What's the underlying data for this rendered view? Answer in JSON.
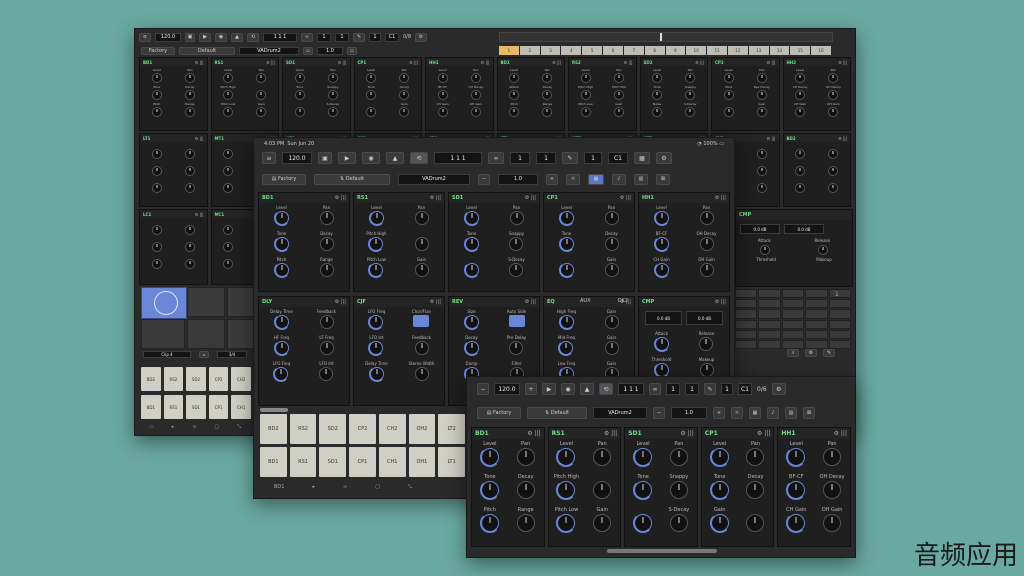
{
  "window_back": {
    "transport": {
      "tempo": "120.0",
      "position": "1 1 1",
      "loop_a": "1",
      "loop_b": "1",
      "loop_c": "1",
      "note": "C1",
      "ratio": "0/8"
    },
    "preset": {
      "factory_label": "Factory",
      "default_label": "Default",
      "name": "VADrum2",
      "value": "1.0"
    },
    "steps": [
      "1",
      "2",
      "3",
      "4",
      "5",
      "6",
      "7",
      "8",
      "9",
      "10",
      "11",
      "12",
      "13",
      "14",
      "15",
      "16"
    ],
    "row1": [
      {
        "name": "BD1",
        "knobs": [
          "Level",
          "Pan",
          "Tone",
          "Decay",
          "Pitch",
          "Range"
        ]
      },
      {
        "name": "RS1",
        "knobs": [
          "Level",
          "Pan",
          "Pitch High",
          "",
          "Pitch Low",
          "Gain"
        ]
      },
      {
        "name": "SD1",
        "knobs": [
          "Level",
          "Pan",
          "Tone",
          "Snappy",
          "",
          "S-Decay"
        ]
      },
      {
        "name": "CP1",
        "knobs": [
          "Level",
          "Pan",
          "Tone",
          "Decay",
          "",
          "Gain"
        ]
      },
      {
        "name": "HH1",
        "knobs": [
          "Level",
          "Pan",
          "BF-CF",
          "CH Decay",
          "CH Gain",
          "OH Gain"
        ]
      },
      {
        "name": "BD2",
        "knobs": [
          "Level",
          "Pan",
          "Attack",
          "Decay",
          "Pitch",
          "Range"
        ]
      },
      {
        "name": "RS2",
        "knobs": [
          "Level",
          "Pan",
          "Pitch High",
          "Pitch Mid",
          "Pitch Low",
          "Gain"
        ]
      },
      {
        "name": "SD2",
        "knobs": [
          "Level",
          "Pan",
          "Tone",
          "Snappy",
          "Noise",
          "S-Decay"
        ]
      },
      {
        "name": "CP2",
        "knobs": [
          "Level",
          "Pan",
          "Tone",
          "Rev Decay",
          "",
          "Gain"
        ]
      },
      {
        "name": "HH2",
        "knobs": [
          "Level",
          "Pan",
          "CH Decay",
          "OH Decay",
          "CH Gain",
          "OH Gain"
        ]
      }
    ],
    "row2": [
      {
        "name": "LT1"
      },
      {
        "name": "MT1"
      },
      {
        "name": "HT1"
      },
      {
        "name": "CY1"
      },
      {
        "name": "CB1"
      },
      {
        "name": "LT2"
      },
      {
        "name": "MT2"
      },
      {
        "name": "HT2"
      },
      {
        "name": "CY2"
      },
      {
        "name": "BD2"
      }
    ],
    "row3": [
      {
        "name": "LC1"
      },
      {
        "name": "MC1"
      }
    ],
    "aux_labels": {
      "aux": "AUX",
      "dk": "DK2",
      "cmp": "CMP",
      "db1": "0.0 dB",
      "db2": "0.0 dB",
      "attack": "Attack",
      "release": "Release",
      "threshold": "Threshold",
      "makeup": "Makeup",
      "page": "1"
    },
    "clip": {
      "name": "Clip 4",
      "count": "3/4"
    },
    "pads_top": [
      "BD2",
      "RS2",
      "SD2",
      "CP2",
      "CH2"
    ],
    "pads_bottom": [
      "BD1",
      "RS1",
      "SD1",
      "CP1",
      "CH1"
    ]
  },
  "window_mid": {
    "status": {
      "time": "4:03 PM",
      "date": "Sun Jun 20",
      "battery": "100%"
    },
    "transport": {
      "tempo": "120.0",
      "position": "1 1 1",
      "loop_a": "1",
      "loop_b": "1",
      "loop_c": "1",
      "note": "C1"
    },
    "preset": {
      "factory_label": "Factory",
      "default_label": "Default",
      "name": "VADrum2",
      "value": "1.0"
    },
    "row1": [
      {
        "name": "BD1",
        "knobs": [
          "Level",
          "Pan",
          "Tone",
          "Decay",
          "Pitch",
          "Range"
        ]
      },
      {
        "name": "RS1",
        "knobs": [
          "Level",
          "Pan",
          "Pitch High",
          "",
          "Pitch Low",
          "Gain"
        ]
      },
      {
        "name": "SD1",
        "knobs": [
          "Level",
          "Pan",
          "Tone",
          "Snappy",
          "",
          "S-Decay"
        ]
      },
      {
        "name": "CP1",
        "knobs": [
          "Level",
          "Pan",
          "Tone",
          "Decay",
          "",
          "Gain"
        ]
      },
      {
        "name": "HH1",
        "knobs": [
          "Level",
          "Pan",
          "BF-CF",
          "OH Decay",
          "CH Gain",
          "OH Gain"
        ]
      }
    ],
    "row2": [
      {
        "name": "DLY",
        "knobs": [
          "Delay Time",
          "Feedback",
          "HF Freq",
          "LF Freq",
          "LFO Freq",
          "LFO Int"
        ]
      },
      {
        "name": "CJF",
        "knobs": [
          "LFO Freq",
          "Chor/Flan",
          "LFO Int",
          "Feedback",
          "Delay Time",
          "Stereo Width"
        ]
      },
      {
        "name": "REV",
        "knobs": [
          "Size",
          "Auto Side",
          "Decay",
          "Pre Delay",
          "Damp",
          "Filter"
        ]
      },
      {
        "name": "EQ",
        "aux": "AUX",
        "dk": "DK2",
        "knobs": [
          "High Freq",
          "Gain",
          "Mid Freq",
          "Gain",
          "Low Freq",
          "Gain"
        ]
      },
      {
        "name": "CMP",
        "db1": "0.0 dB",
        "db2": "0.0 dB",
        "knobs": [
          "Attack",
          "Release",
          "Threshold",
          "Makeup"
        ]
      }
    ],
    "pads_top": [
      "BD2",
      "RS2",
      "SD2",
      "CP2",
      "CH2",
      "OH2",
      "LT2"
    ],
    "pads_bottom": [
      "BD1",
      "RS1",
      "SD1",
      "CP1",
      "CH1",
      "OH1",
      "LT1"
    ],
    "footer": {
      "label": "BD1"
    }
  },
  "window_front": {
    "transport": {
      "tempo": "120.0",
      "position": "1 1 1",
      "loop_a": "1",
      "loop_b": "1",
      "loop_c": "1",
      "note": "C1",
      "ratio": "0/6"
    },
    "preset": {
      "factory_label": "Factory",
      "default_label": "Default",
      "name": "VADrum2",
      "value": "1.0"
    },
    "modules": [
      {
        "name": "BD1",
        "knobs": [
          "Level",
          "Pan",
          "Tone",
          "Decay",
          "Pitch",
          "Range"
        ]
      },
      {
        "name": "RS1",
        "knobs": [
          "Level",
          "Pan",
          "Pitch High",
          "",
          "Pitch Low",
          "Gain"
        ]
      },
      {
        "name": "SD1",
        "knobs": [
          "Level",
          "Pan",
          "Tone",
          "Snappy",
          "",
          "S-Decay"
        ]
      },
      {
        "name": "CP1",
        "knobs": [
          "Level",
          "Pan",
          "Tone",
          "Decay",
          "Gain",
          ""
        ]
      },
      {
        "name": "HH1",
        "knobs": [
          "Level",
          "Pan",
          "BF-CF",
          "OH Decay",
          "CH Gain",
          "OH Gain"
        ]
      }
    ]
  },
  "watermark": "音频应用"
}
